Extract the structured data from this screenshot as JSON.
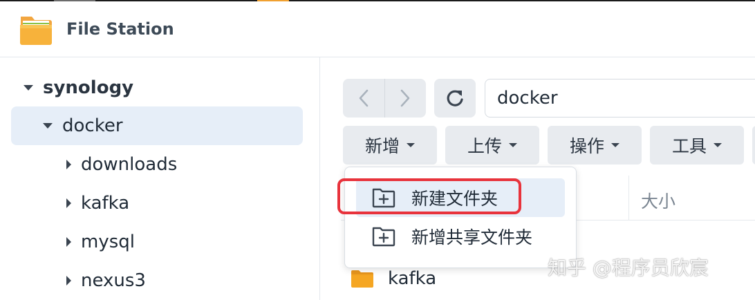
{
  "app": {
    "title": "File Station",
    "icon": "folder-app-icon"
  },
  "sidebar": {
    "root": {
      "label": "synology",
      "expanded": true
    },
    "items": [
      {
        "label": "docker",
        "expanded": true,
        "selected": true
      },
      {
        "label": "downloads",
        "expanded": false
      },
      {
        "label": "kafka",
        "expanded": false
      },
      {
        "label": "mysql",
        "expanded": false
      },
      {
        "label": "nexus3",
        "expanded": false
      }
    ]
  },
  "toolbar": {
    "path": "docker",
    "buttons": [
      {
        "label": "新增"
      },
      {
        "label": "上传"
      },
      {
        "label": "操作"
      },
      {
        "label": "工具"
      }
    ]
  },
  "menu": {
    "items": [
      {
        "label": "新建文件夹",
        "icon": "new-folder-icon"
      },
      {
        "label": "新增共享文件夹",
        "icon": "new-folder-icon"
      }
    ]
  },
  "list": {
    "columns": {
      "size": "大小"
    },
    "rows": [
      {
        "name": "kafka",
        "icon": "folder-icon"
      }
    ]
  },
  "watermark": "知乎 @程序员欣宸",
  "colors": {
    "highlight": "#e8333c",
    "selected_bg": "#e6eef8",
    "button_bg": "#e8ebef",
    "folder": "#f5a623"
  }
}
